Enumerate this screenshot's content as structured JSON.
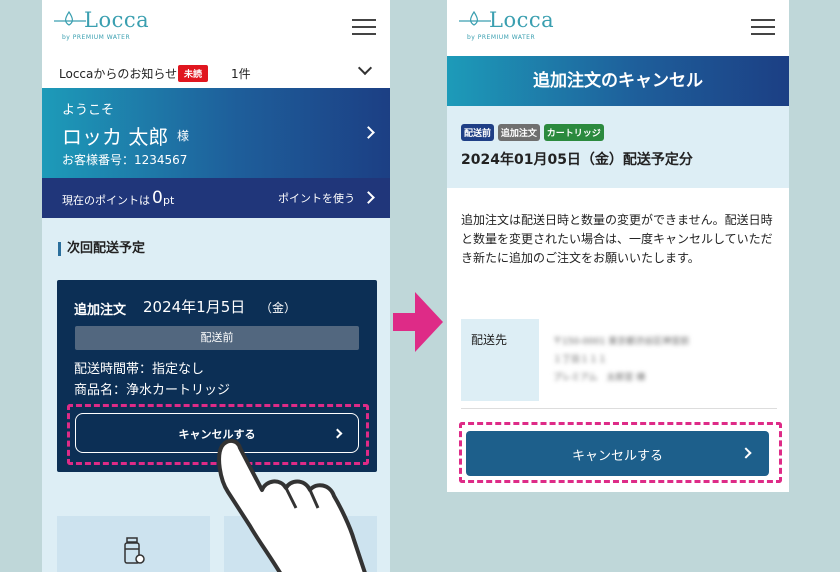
{
  "brand": {
    "logo": "Locca",
    "sub": "by PREMIUM WATER",
    "color": "#3a9fb0"
  },
  "left": {
    "notice": {
      "text": "Loccaからのお知らせ",
      "badge": "未読",
      "count": "1件"
    },
    "welcome": {
      "greeting": "ようこそ",
      "name": "ロッカ 太郎",
      "suffix": "様",
      "customer_no": "お客様番号：1234567"
    },
    "points": {
      "label": "現在のポイントは",
      "value": "0",
      "unit": "pt",
      "use": "ポイントを使う"
    },
    "section_title": "次回配送予定",
    "order": {
      "kind": "追加注文",
      "date": "2024年1月5日",
      "weekday": "（金）",
      "status": "配送前",
      "time": "配送時間帯：指定なし",
      "product": "商品名：浄水カートリッジ",
      "cancel": "キャンセルする"
    }
  },
  "right": {
    "title": "追加注文のキャンセル",
    "tags": [
      {
        "label": "配送前",
        "color": "#1f3f86"
      },
      {
        "label": "追加注文",
        "color": "#6f6f6f"
      },
      {
        "label": "カートリッジ",
        "color": "#2b8a3e"
      }
    ],
    "date": "2024年01月05日（金）配送予定分",
    "description": "追加注文は配送日時と数量の変更ができません。配送日時と数量を変更されたい場合は、一度キャンセルしていただき新たに追加のご注文をお願いいたします。",
    "address_label": "配送先",
    "address_lines": [
      "〒150-0001 東京都渋谷区神宮前",
      "１丁目１１１",
      "プレミアム　太郎宮 棟"
    ],
    "cancel": "キャンセルする"
  },
  "colors": {
    "highlight": "#de2b87",
    "unread": "#e0161f"
  }
}
